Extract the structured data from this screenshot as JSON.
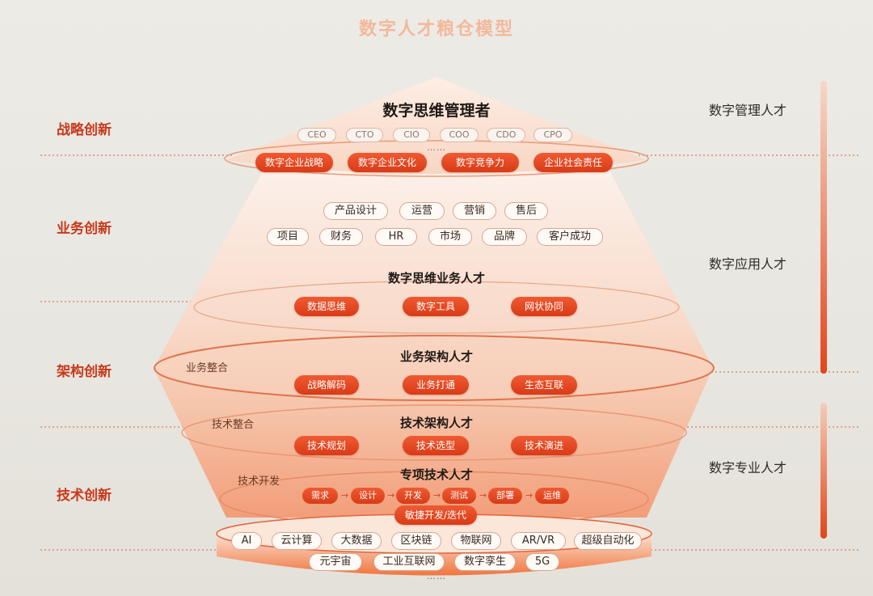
{
  "title": "数字人才粮仓模型",
  "innovation_levels": [
    "战略创新",
    "业务创新",
    "架构创新",
    "技术创新"
  ],
  "talent_categories": [
    "数字管理人才",
    "数字应用人才",
    "数字专业人才"
  ],
  "top_layer": {
    "heading": "数字思维管理者",
    "roles": [
      "CEO",
      "CTO",
      "CIO",
      "COO",
      "CDO",
      "CPO"
    ],
    "ellipsis": "……",
    "capabilities": [
      "数字企业战略",
      "数字企业文化",
      "数字竞争力",
      "企业社会责任"
    ]
  },
  "business_functions": {
    "row1": [
      "产品设计",
      "运营",
      "营销",
      "售后"
    ],
    "row2": [
      "项目",
      "财务",
      "HR",
      "市场",
      "品牌",
      "客户成功"
    ]
  },
  "business_talent": {
    "heading": "数字思维业务人才",
    "skills": [
      "数据思维",
      "数字工具",
      "网状协同"
    ]
  },
  "business_architecture": {
    "side_label": "业务整合",
    "heading": "业务架构人才",
    "skills": [
      "战略解码",
      "业务打通",
      "生态互联"
    ]
  },
  "tech_architecture": {
    "side_label": "技术整合",
    "heading": "技术架构人才",
    "skills": [
      "技术规划",
      "技术选型",
      "技术演进"
    ]
  },
  "specialist": {
    "side_label": "技术开发",
    "heading": "专项技术人才",
    "flow": [
      "需求",
      "设计",
      "开发",
      "测试",
      "部署",
      "运维"
    ],
    "agile": "敏捷开发/迭代"
  },
  "technologies": {
    "row1": [
      "AI",
      "云计算",
      "大数据",
      "区块链",
      "物联网",
      "AR/VR",
      "超级自动化"
    ],
    "row2": [
      "元宇宙",
      "工业互联网",
      "数字孪生",
      "5G"
    ],
    "ellipsis": "……"
  },
  "colors": {
    "accent": "#e0451f",
    "accent_dark": "#c8391a",
    "title": "#f4b89a",
    "bar": "#e54a22"
  }
}
